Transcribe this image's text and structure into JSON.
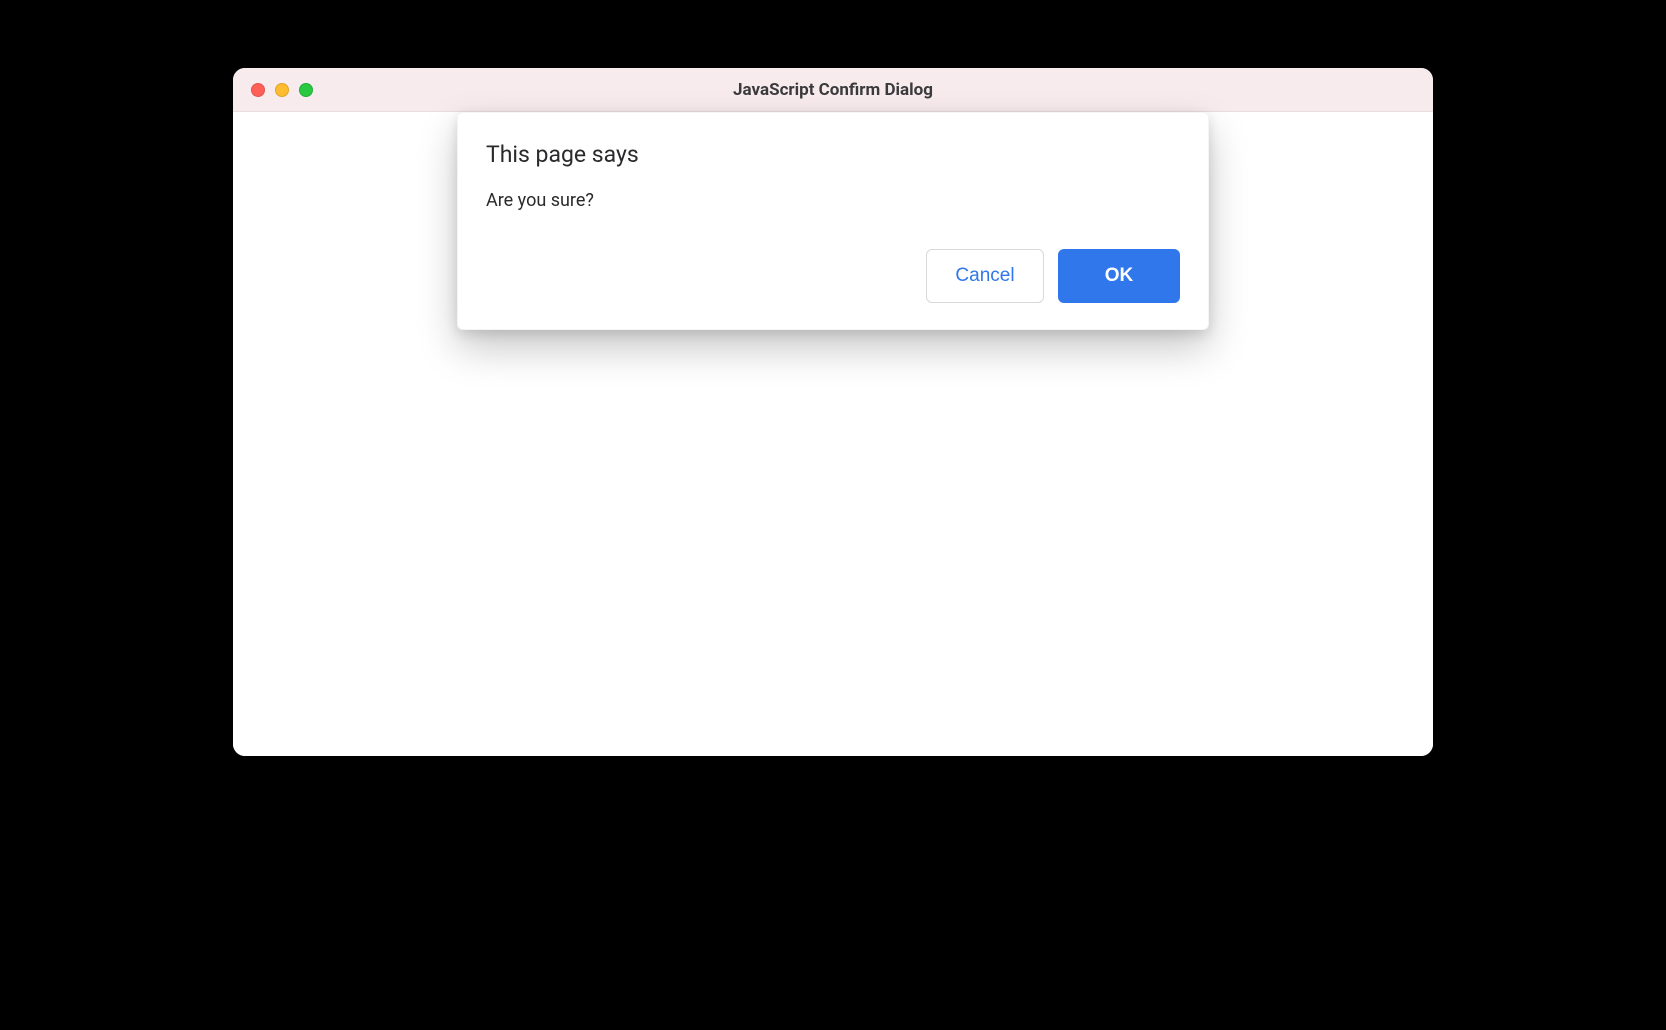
{
  "window": {
    "title": "JavaScript Confirm Dialog"
  },
  "dialog": {
    "heading": "This page says",
    "message": "Are you sure?",
    "cancel_label": "Cancel",
    "ok_label": "OK"
  }
}
